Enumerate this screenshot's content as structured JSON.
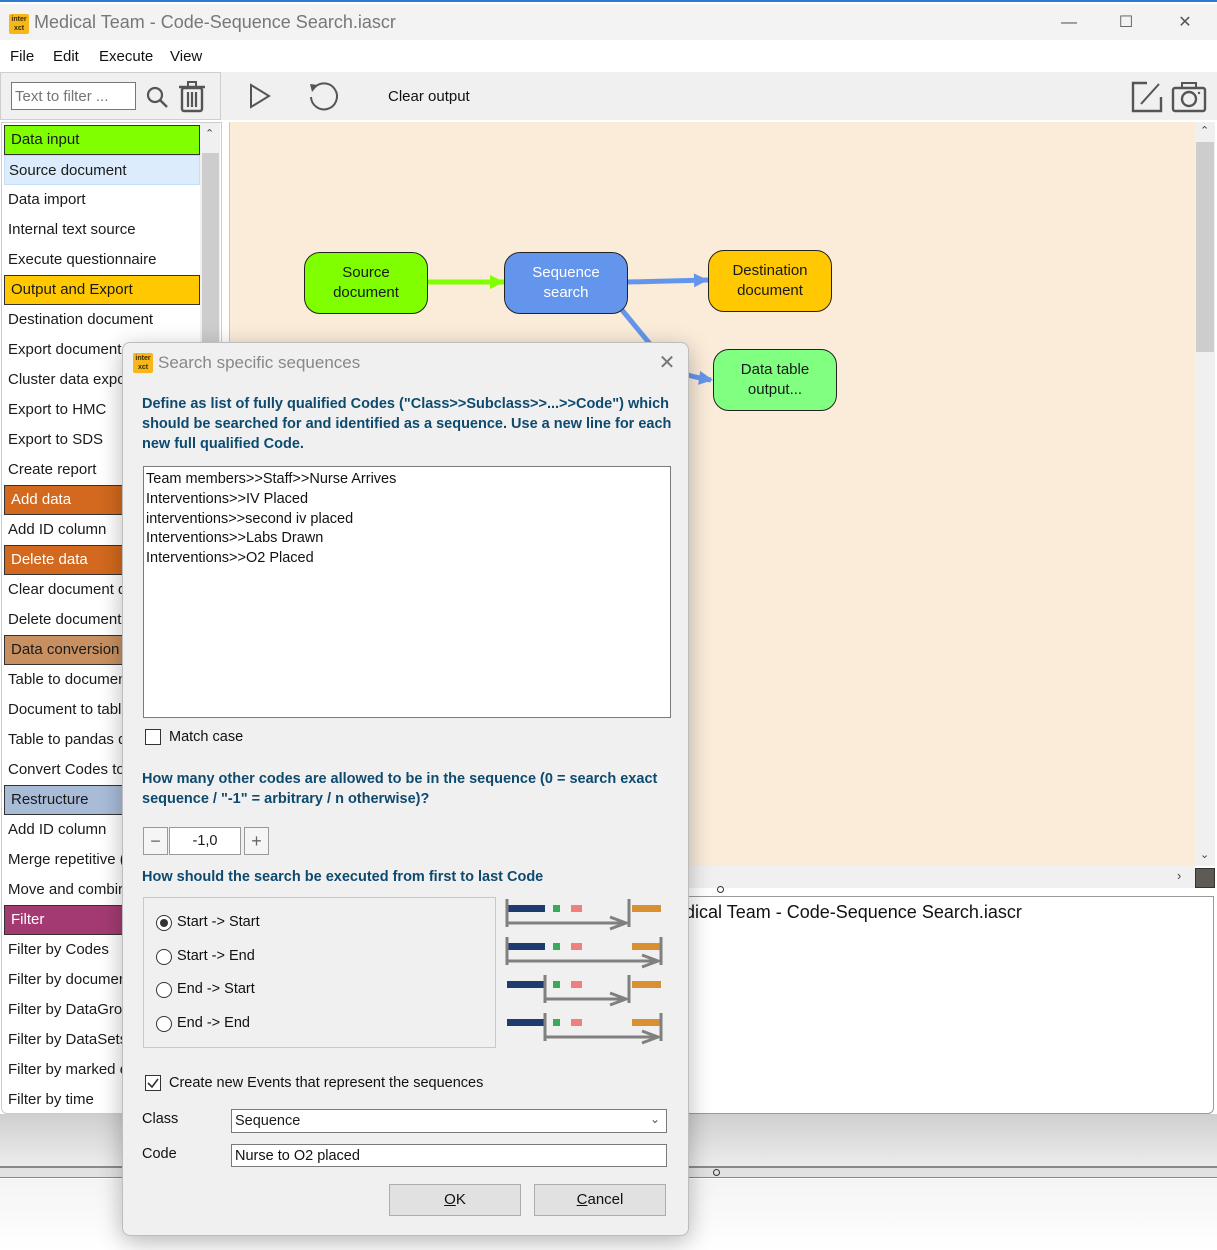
{
  "window": {
    "title": "Medical Team - Code-Sequence Search.iascr",
    "app_icon_text": "inter\nxct",
    "controls": {
      "minimize": "—",
      "maximize": "☐",
      "close": "✕"
    }
  },
  "menu": [
    "File",
    "Edit",
    "Execute",
    "View"
  ],
  "toolbar": {
    "filter_placeholder": "Text to filter ...",
    "filter_value": "",
    "clear_output_label": "Clear output",
    "icons": [
      "search-icon",
      "trash-icon",
      "play-icon",
      "reset-icon",
      "edit-icon",
      "camera-icon"
    ]
  },
  "sidebar": {
    "items": [
      {
        "label": "Data input",
        "type": "category",
        "color": "#80ff00"
      },
      {
        "label": "Source document",
        "type": "item",
        "selected": true
      },
      {
        "label": "Data import",
        "type": "item"
      },
      {
        "label": "Internal text source",
        "type": "item"
      },
      {
        "label": "Execute questionnaire",
        "type": "item"
      },
      {
        "label": "Output and Export",
        "type": "category",
        "color": "#ffc800"
      },
      {
        "label": "Destination document",
        "type": "item"
      },
      {
        "label": "Export document",
        "type": "item"
      },
      {
        "label": "Cluster data expo",
        "type": "item"
      },
      {
        "label": "Export to HMC",
        "type": "item"
      },
      {
        "label": "Export to SDS",
        "type": "item"
      },
      {
        "label": "Create report",
        "type": "item"
      },
      {
        "label": "Add data",
        "type": "category",
        "color": "#d2691e"
      },
      {
        "label": "Add ID column",
        "type": "item"
      },
      {
        "label": "Delete data",
        "type": "category",
        "color": "#d2691e"
      },
      {
        "label": "Clear document d",
        "type": "item"
      },
      {
        "label": "Delete document",
        "type": "item"
      },
      {
        "label": "Data conversion",
        "type": "category",
        "color": "#c89060"
      },
      {
        "label": "Table to documen",
        "type": "item"
      },
      {
        "label": "Document to tabl",
        "type": "item"
      },
      {
        "label": "Table to pandas d",
        "type": "item"
      },
      {
        "label": "Convert Codes to",
        "type": "item"
      },
      {
        "label": "Restructure",
        "type": "category",
        "color": "#a8bcd8"
      },
      {
        "label": "Add ID column",
        "type": "item"
      },
      {
        "label": "Merge repetitive (",
        "type": "item"
      },
      {
        "label": "Move and combir",
        "type": "item"
      },
      {
        "label": "Filter",
        "type": "category",
        "color": "#a33b72"
      },
      {
        "label": "Filter by Codes",
        "type": "item"
      },
      {
        "label": "Filter by documer",
        "type": "item"
      },
      {
        "label": "Filter by DataGrou",
        "type": "item"
      },
      {
        "label": "Filter by DataSets",
        "type": "item"
      },
      {
        "label": "Filter by marked e",
        "type": "item"
      },
      {
        "label": "Filter by time",
        "type": "item"
      }
    ]
  },
  "canvas": {
    "background": "#fbebd9",
    "nodes": [
      {
        "id": "source",
        "label_lines": [
          "Source",
          "document"
        ],
        "color": "#80ff00",
        "text_color": "#1a1a1a"
      },
      {
        "id": "sequence",
        "label_lines": [
          "Sequence",
          "search"
        ],
        "color": "#6495ed",
        "text_color": "#ffffff"
      },
      {
        "id": "destination",
        "label_lines": [
          "Destination",
          "document"
        ],
        "color": "#ffc800",
        "text_color": "#1a1a1a"
      },
      {
        "id": "datatable",
        "label_lines": [
          "Data table",
          "output..."
        ],
        "color": "#80ff80",
        "text_color": "#1a1a1a"
      }
    ],
    "edges": [
      {
        "from": "source",
        "to": "sequence",
        "color": "#80ff00"
      },
      {
        "from": "sequence",
        "to": "destination",
        "color": "#6495ed"
      },
      {
        "from": "sequence",
        "to": "datatable",
        "color": "#6495ed"
      }
    ]
  },
  "output": {
    "text": "edical Team - Code-Sequence Search.iascr"
  },
  "dialog": {
    "title": "Search specific sequences",
    "close": "✕",
    "heading1": "Define as list of fully qualified Codes (\"Class>>Subclass>>...>>Code\") which should be searched for and identified as a sequence. Use a new line for each new full qualified Code.",
    "codes": "Team members>>Staff>>Nurse Arrives\nInterventions>>IV Placed\ninterventions>>second iv placed\nInterventions>>Labs Drawn\nInterventions>>O2 Placed",
    "match_case_label": "Match case",
    "match_case_checked": false,
    "heading2": "How many other codes are allowed to be in the sequence (0 = search exact sequence / \"-1\" = arbitrary / n otherwise)?",
    "stepper": {
      "minus": "−",
      "value": "-1,0",
      "plus": "+"
    },
    "heading3": "How should the search be executed from first to last Code",
    "search_modes": [
      {
        "label": "Start -> Start",
        "selected": true
      },
      {
        "label": "Start -> End",
        "selected": false
      },
      {
        "label": "End -> Start",
        "selected": false
      },
      {
        "label": "End -> End",
        "selected": false
      }
    ],
    "create_events_label": "Create new Events that represent the sequences",
    "create_events_checked": true,
    "class_label": "Class",
    "class_value": "Sequence",
    "code_label": "Code",
    "code_value": "Nurse to O2 placed",
    "ok_label": "OK",
    "cancel_label": "Cancel",
    "diagram_colors": {
      "first": "#1f3a6e",
      "mid1": "#3aaa5a",
      "mid2": "#f08080",
      "last": "#d89030",
      "arrow": "#808080"
    }
  }
}
